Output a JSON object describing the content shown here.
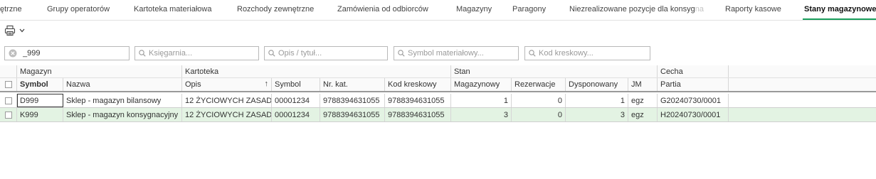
{
  "tabs": [
    {
      "label": "ętrzne"
    },
    {
      "label": "Grupy operatorów"
    },
    {
      "label": "Kartoteka materiałowa"
    },
    {
      "label": "Rozchody zewnętrzne"
    },
    {
      "label": "Zamówienia od odbiorców"
    },
    {
      "label": "Magazyny"
    },
    {
      "label": "Paragony"
    },
    {
      "label_main": "Niezrealizowane pozycje dla konsyg",
      "label_fade": "na"
    },
    {
      "label": "Raporty kasowe"
    },
    {
      "label": "Stany magazynowe"
    }
  ],
  "toolbar": {
    "print_icon": "printer-icon",
    "dropdown_icon": "chevron-down-icon"
  },
  "filters": {
    "magazyn_value": "_999",
    "ksiegarnia_placeholder": "Księgarnia...",
    "opis_placeholder": "Opis / tytuł...",
    "symbol_placeholder": "Symbol materiałowy...",
    "kod_placeholder": "Kod kreskowy..."
  },
  "grid": {
    "group_headers": {
      "magazyn": "Magazyn",
      "kartoteka": "Kartoteka",
      "stan": "Stan",
      "cecha": "Cecha"
    },
    "columns": {
      "symbol": "Symbol",
      "nazwa": "Nazwa",
      "opis": "Opis",
      "symbol_mat": "Symbol",
      "nr_kat": "Nr. kat.",
      "kod": "Kod kreskowy",
      "magazynowy": "Magazynowy",
      "rezerwacje": "Rezerwacje",
      "dysponowany": "Dysponowany",
      "jm": "JM",
      "partia": "Partia"
    },
    "sort_indicator": "↑",
    "rows": [
      {
        "symbol": "D999",
        "nazwa": "Sklep - magazyn bilansowy",
        "opis": "12 ŻYCIOWYCH ZASAD",
        "symbol_mat": "00001234",
        "nr_kat": "9788394631055",
        "kod": "9788394631055",
        "magazynowy": "1",
        "rezerwacje": "0",
        "dysponowany": "1",
        "jm": "egz",
        "partia": "G20240730/0001"
      },
      {
        "symbol": "K999",
        "nazwa": "Sklep - magazyn konsygnacyjny",
        "opis": "12 ŻYCIOWYCH ZASAD",
        "symbol_mat": "00001234",
        "nr_kat": "9788394631055",
        "kod": "9788394631055",
        "magazynowy": "3",
        "rezerwacje": "0",
        "dysponowany": "3",
        "jm": "egz",
        "partia": "H20240730/0001"
      }
    ]
  },
  "colors": {
    "accent": "#1a9e5c",
    "selected_row": "#e3f3e3"
  }
}
